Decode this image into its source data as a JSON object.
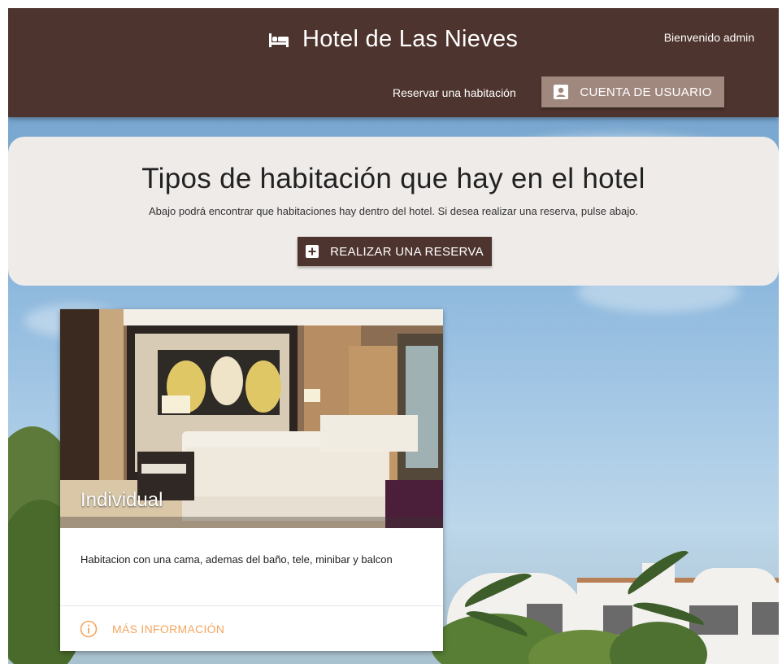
{
  "header": {
    "brand_icon": "hotel-bed-icon",
    "title": "Hotel de Las Nieves",
    "welcome": "Bienvenido admin",
    "nav_reserve": "Reservar una habitación",
    "account_button": "CUENTA DE USUARIO",
    "account_icon": "account-box-icon",
    "bg_color": "#4e342e",
    "button_color": "#a1887f"
  },
  "hero": {
    "title": "Tipos de habitación que hay en el hotel",
    "subtitle": "Abajo podrá encontrar que habitaciones hay dentro del hotel. Si desea realizar una reserva, pulse abajo.",
    "reserve_button": "REALIZAR UNA RESERVA",
    "reserve_icon": "add-box-icon",
    "bg_color": "#efebe9"
  },
  "rooms": [
    {
      "title": "Individual",
      "description": "Habitacion con una cama, ademas del baño, tele, minibar y balcon",
      "action": "MÁS INFORMACIÓN",
      "action_icon": "info-icon",
      "action_color": "#f4a65f"
    }
  ]
}
